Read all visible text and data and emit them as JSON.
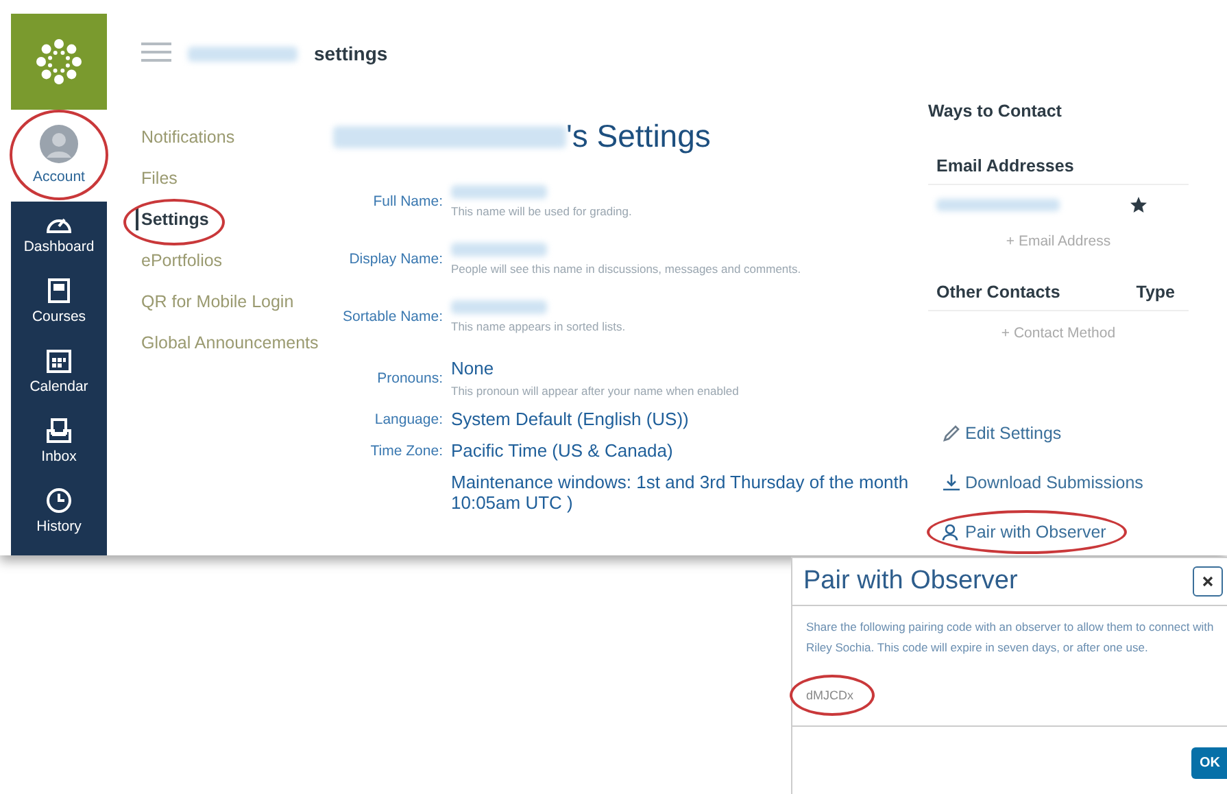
{
  "global_nav": {
    "items": [
      {
        "kind": "account",
        "label": "Account",
        "selected": true
      },
      {
        "kind": "dashboard",
        "label": "Dashboard",
        "selected": false
      },
      {
        "kind": "courses",
        "label": "Courses",
        "selected": false
      },
      {
        "kind": "calendar",
        "label": "Calendar",
        "selected": false
      },
      {
        "kind": "inbox",
        "label": "Inbox",
        "selected": false
      },
      {
        "kind": "history",
        "label": "History",
        "selected": false
      }
    ]
  },
  "header": {
    "title": "settings"
  },
  "sub_nav": {
    "items": [
      {
        "label": "Notifications",
        "selected": false
      },
      {
        "label": "Files",
        "selected": false
      },
      {
        "label": "Settings",
        "selected": true
      },
      {
        "label": "ePortfolios",
        "selected": false
      },
      {
        "label": "QR for Mobile Login",
        "selected": false
      },
      {
        "label": "Global Announcements",
        "selected": false
      }
    ]
  },
  "page_heading": "'s Settings",
  "fields": [
    {
      "label": "Full Name:",
      "kind": "redacted",
      "hint": "This name will be used for grading."
    },
    {
      "label": "Display Name:",
      "kind": "redacted",
      "hint": "People will see this name in discussions, messages and comments."
    },
    {
      "label": "Sortable Name:",
      "kind": "redacted",
      "hint": "This name appears in sorted lists."
    },
    {
      "label": "Pronouns:",
      "kind": "text",
      "value": "None",
      "hint": "This pronoun will appear after your name when enabled"
    },
    {
      "label": "Language:",
      "kind": "text",
      "value": "System Default (English (US))"
    },
    {
      "label": "Time Zone:",
      "kind": "text",
      "value": "Pacific Time (US & Canada)"
    },
    {
      "kind": "text",
      "value": "Maintenance windows: 1st and 3rd Thursday of the month 10:05am UTC )"
    }
  ],
  "ways_to_contact": {
    "title": "Ways to Contact",
    "email_header": "Email Addresses",
    "add_email": "+ Email Address",
    "other_header": "Other Contacts",
    "type_header": "Type",
    "add_contact": "+ Contact Method"
  },
  "actions": [
    {
      "kind": "edit",
      "label": "Edit Settings"
    },
    {
      "kind": "download",
      "label": "Download Submissions"
    },
    {
      "kind": "pair",
      "label": "Pair with Observer"
    }
  ],
  "dialog": {
    "title": "Pair with Observer",
    "body": "Share the following pairing code with an observer to allow them to connect with Riley Sochia. This code will expire in seven days, or after one use.",
    "code": "dMJCDx",
    "ok": "OK"
  }
}
